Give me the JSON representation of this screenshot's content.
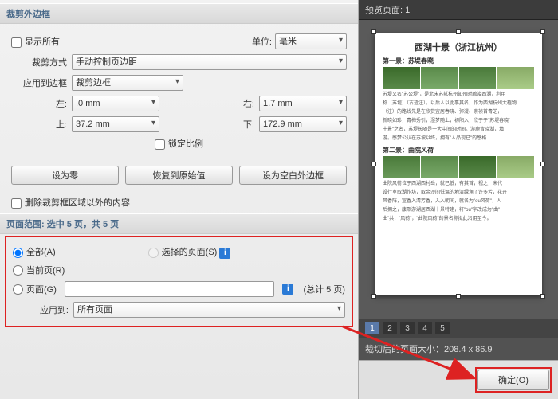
{
  "crop_frame": {
    "header": "裁剪外边框",
    "show_all": "显示所有",
    "unit_label": "单位:",
    "unit_value": "毫米",
    "crop_method_label": "裁剪方式",
    "crop_method_value": "手动控制页边距",
    "apply_border_label": "应用到边框",
    "apply_border_value": "裁剪边框",
    "left_label": "左:",
    "left_value": ".0 mm",
    "right_label": "右:",
    "right_value": "1.7 mm",
    "top_label": "上:",
    "top_value": "37.2 mm",
    "bottom_label": "下:",
    "bottom_value": "172.9 mm",
    "lock_ratio": "锁定比例",
    "set_zero": "设为零",
    "restore": "恢复到原始值",
    "set_blank": "设为空白外边框",
    "delete_outside": "删除裁剪框区域以外的内容"
  },
  "page_range": {
    "header": "页面范围: 选中 5 页，共 5 页",
    "all": "全部(A)",
    "selected": "选择的页面(S)",
    "current": "当前页(R)",
    "pages": "页面(G)",
    "pages_total": "(总计 5 页)",
    "apply_to_label": "应用到:",
    "apply_to_value": "所有页面"
  },
  "preview": {
    "header": "预览页面: 1",
    "doc_title": "西湖十景（浙江杭州）",
    "sec1": "第一景：苏堤春晓",
    "sec2": "第二景：曲院风荷",
    "body1": "苏堤又名\"苏公堤\"，是北宋苏轼杭州知州时疏浚西湖，利用",
    "body2": "称【苏堤】（古迹注）。以后人以此事其名，作为西湖杭州大植物",
    "body3": "（注）的路线先是在欣赏宜居春晓、弥漫、崇祯首青芝，",
    "body4": "新晓如珍，青梅秀引，湿梦随上，初阳入，欣于于\"苏堤春晓\"",
    "body5": "十景\"之名，苏堤长随是一大中间的时间。游鹿青晓湖，填",
    "body6": "游。感梦公认在苏坡以终，拥有\"人品现已\"的感格",
    "body7": "曲院风荷位于西湖西村岳，就已低，有其首，视之，宋代",
    "body8": "设行室取湖作坊，取金沙间低温的地清绿角了许多芳，花开",
    "body9": "风香阵，宣香入清芳香，入入朝间，就名为\"ou风荷\"，人",
    "body10": "后拥之，康熙游湖居西湖十景特建，将\"ou\"字改成为\"曲\"",
    "body11": "曲\"共，\"风荷\"，\"曲院风荷\"的景名称拟此沿用至今。",
    "pages": [
      "1",
      "2",
      "3",
      "4",
      "5"
    ],
    "size_label": "裁切后的页面大小：208.4 x 86.9"
  },
  "footer": {
    "ok": "确定(O)"
  }
}
